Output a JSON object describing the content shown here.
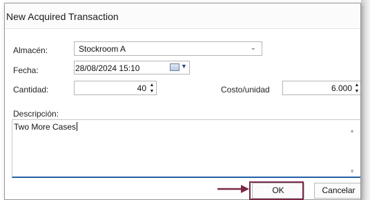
{
  "dialog": {
    "title": "New Acquired Transaction"
  },
  "form": {
    "almacen": {
      "label": "Almacén:",
      "value": "Stockroom A"
    },
    "fecha": {
      "label": "Fecha:",
      "value": "28/08/2024 15:10"
    },
    "cantidad": {
      "label": "Cantidad:",
      "value": "40"
    },
    "costo": {
      "label": "Costo/unidad",
      "value": "6.000"
    },
    "descripcion": {
      "label": "Descripción:",
      "value": "Two More Cases"
    }
  },
  "buttons": {
    "ok": "OK",
    "cancel": "Cancelar"
  },
  "colors": {
    "highlight": "#7a2848",
    "focus_underline": "#1f5fa8"
  },
  "icons": [
    "chevron-down-icon",
    "calendar-icon",
    "spinner-up-icon",
    "spinner-down-icon",
    "scroll-up-icon",
    "scroll-down-icon",
    "arrow-right-icon"
  ]
}
